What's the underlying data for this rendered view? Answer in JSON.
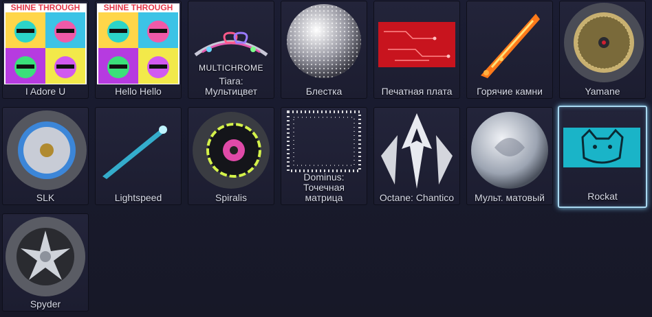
{
  "items": [
    {
      "name": "I Adore U",
      "banner": "SHINE THROUGH"
    },
    {
      "name": "Hello Hello",
      "banner": "SHINE THROUGH"
    },
    {
      "name": "Tiara:\nМультицвет",
      "badge": "MULTICHROME"
    },
    {
      "name": "Блестка"
    },
    {
      "name": "Печатная плата"
    },
    {
      "name": "Горячие камни"
    },
    {
      "name": "Yamane"
    },
    {
      "name": "SLK"
    },
    {
      "name": "Lightspeed"
    },
    {
      "name": "Spiralis"
    },
    {
      "name": "Dominus:\nТочечная\nматрица"
    },
    {
      "name": "Octane: Chantico"
    },
    {
      "name": "Мульт. матовый"
    },
    {
      "name": "Rockat"
    },
    {
      "name": "Spyder"
    }
  ],
  "selected_index": 13
}
